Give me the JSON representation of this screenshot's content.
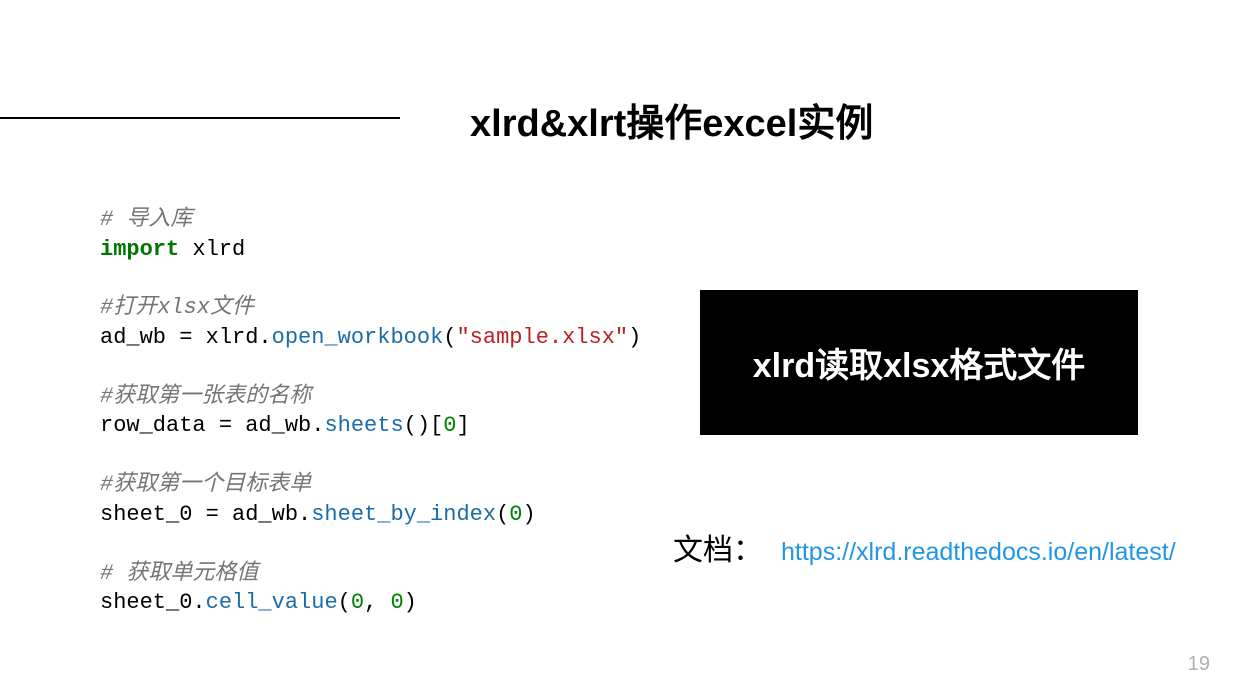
{
  "title": "xlrd&xlrt操作excel实例",
  "code": {
    "c1": "# 导入库",
    "kw_import": "import",
    "import_mod": " xlrd",
    "c2": "#打开xlsx文件",
    "l3_a": "ad_wb = xlrd.",
    "l3_fn": "open_workbook",
    "l3_b": "(",
    "l3_str": "\"sample.xlsx\"",
    "l3_c": ")",
    "c3": "#获取第一张表的名称",
    "l5_a": "row_data = ad_wb.",
    "l5_fn": "sheets",
    "l5_b": "()[",
    "l5_num": "0",
    "l5_c": "]",
    "c4": "#获取第一个目标表单",
    "l7_a": "sheet_0 = ad_wb.",
    "l7_fn": "sheet_by_index",
    "l7_b": "(",
    "l7_num": "0",
    "l7_c": ")",
    "c5": "# 获取单元格值",
    "l9_a": "sheet_0.",
    "l9_fn": "cell_value",
    "l9_b": "(",
    "l9_num1": "0",
    "l9_mid": ", ",
    "l9_num2": "0",
    "l9_c": ")"
  },
  "callout": "xlrd读取xlsx格式文件",
  "doc_label": "文档：",
  "doc_url": "https://xlrd.readthedocs.io/en/latest/",
  "page_number": "19"
}
